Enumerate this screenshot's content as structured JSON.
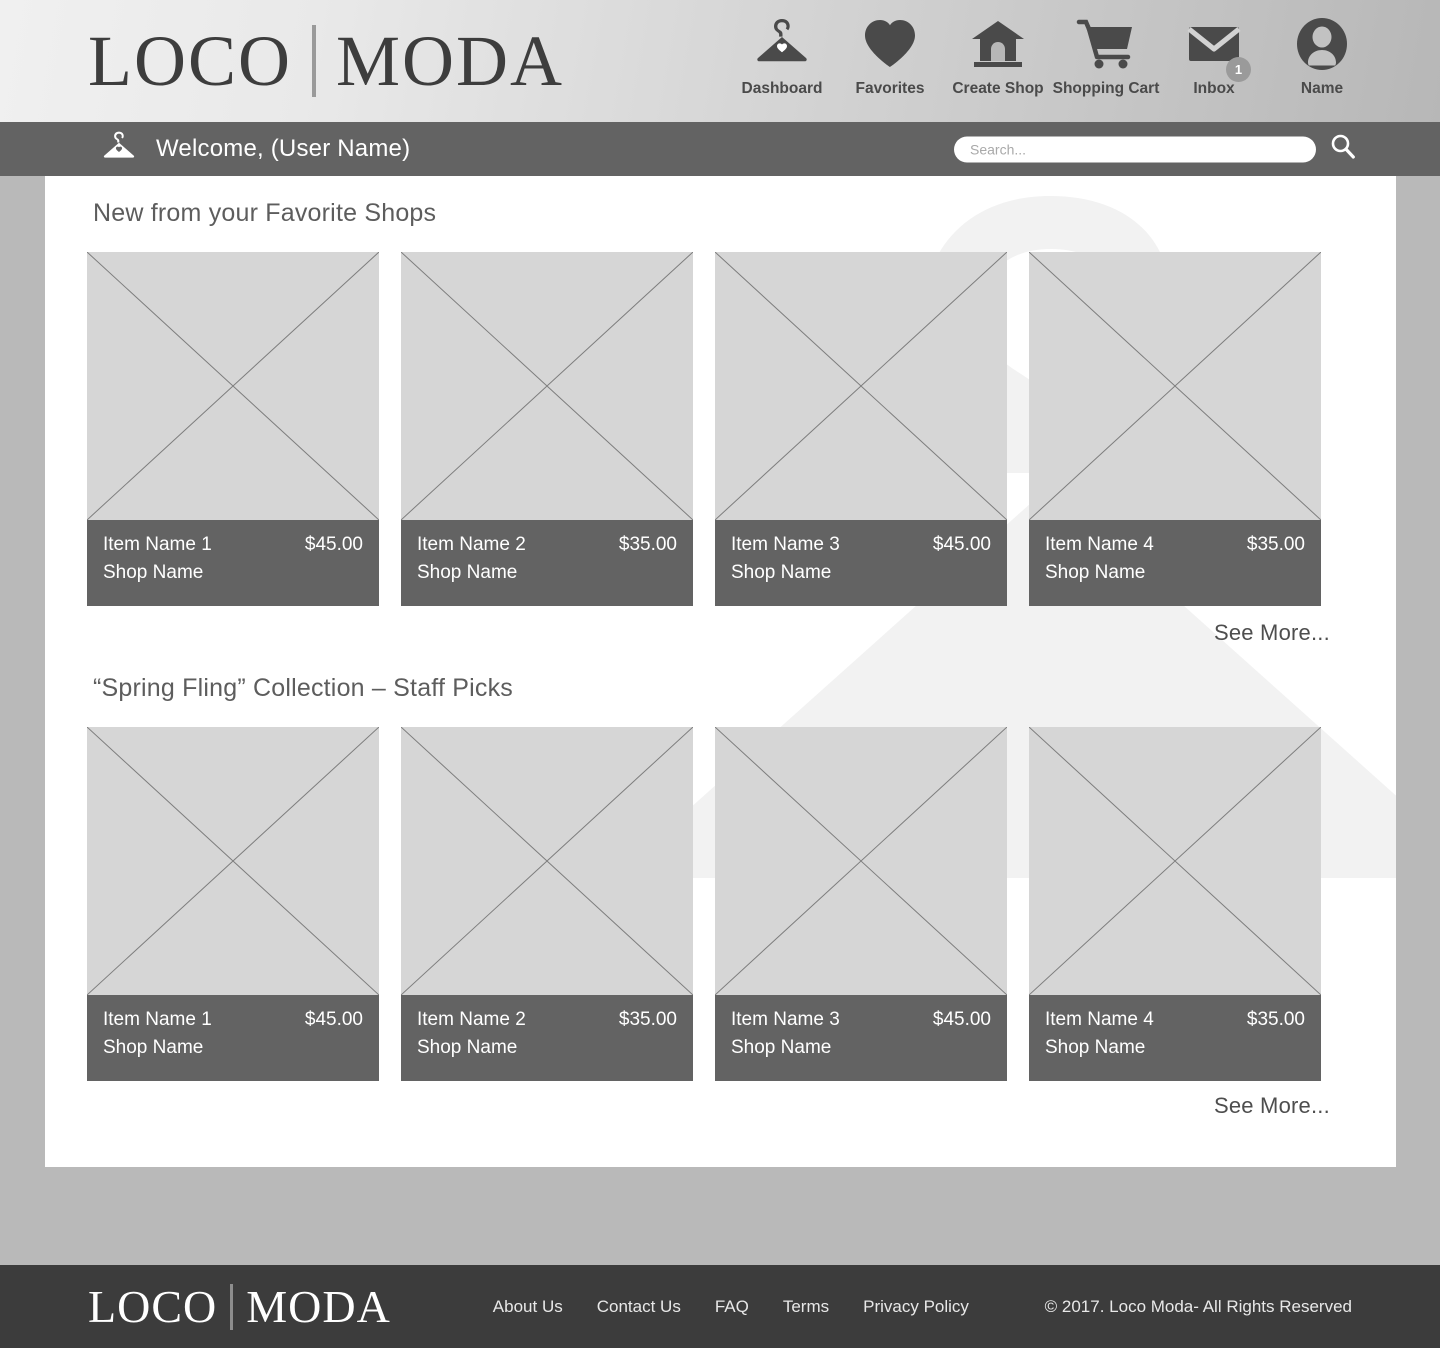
{
  "brand": {
    "word1": "LOCO",
    "word2": "MODA"
  },
  "nav": {
    "items": [
      {
        "label": "Dashboard",
        "icon": "hanger-heart-icon"
      },
      {
        "label": "Favorites",
        "icon": "heart-icon"
      },
      {
        "label": "Create Shop",
        "icon": "shop-house-icon"
      },
      {
        "label": "Shopping Cart",
        "icon": "shopping-cart-icon"
      },
      {
        "label": "Inbox",
        "icon": "envelope-icon",
        "badge": "1"
      },
      {
        "label": "Name",
        "icon": "user-avatar-icon"
      }
    ]
  },
  "welcome": {
    "text": "Welcome, (User Name)",
    "icon": "hanger-heart-icon"
  },
  "search": {
    "placeholder": "Search...",
    "value": "",
    "icon": "search-icon"
  },
  "sections": [
    {
      "title": "New from your Favorite Shops",
      "see_more": "See More...",
      "cards": [
        {
          "name": "Item Name 1",
          "price": "$45.00",
          "shop": "Shop Name"
        },
        {
          "name": "Item Name 2",
          "price": "$35.00",
          "shop": "Shop Name"
        },
        {
          "name": "Item Name 3",
          "price": "$45.00",
          "shop": "Shop Name"
        },
        {
          "name": "Item Name 4",
          "price": "$35.00",
          "shop": "Shop Name"
        }
      ]
    },
    {
      "title": "“Spring Fling” Collection – Staff Picks",
      "see_more": "See More...",
      "cards": [
        {
          "name": "Item Name 1",
          "price": "$45.00",
          "shop": "Shop Name"
        },
        {
          "name": "Item Name 2",
          "price": "$35.00",
          "shop": "Shop Name"
        },
        {
          "name": "Item Name 3",
          "price": "$45.00",
          "shop": "Shop Name"
        },
        {
          "name": "Item Name 4",
          "price": "$35.00",
          "shop": "Shop Name"
        }
      ]
    }
  ],
  "footer": {
    "links": [
      "About Us",
      "Contact Us",
      "FAQ",
      "Terms",
      "Privacy Policy"
    ],
    "copyright": "© 2017.  Loco Moda- All Rights Reserved"
  },
  "colors": {
    "page_bg": "#b9b9b9",
    "bar_gray": "#636363",
    "footer_dark": "#3c3c3c",
    "placeholder": "#d6d6d6",
    "text_dark": "#3d3d3d"
  }
}
